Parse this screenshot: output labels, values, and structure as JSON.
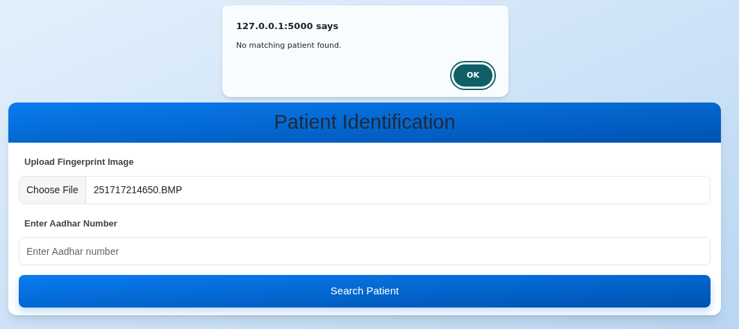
{
  "dialog": {
    "title": "127.0.0.1:5000 says",
    "message": "No matching patient found.",
    "button": "OK"
  },
  "form": {
    "title": "Patient Identification",
    "fingerprint": {
      "label": "Upload Fingerprint Image",
      "button": "Choose File",
      "value": "251717214650.BMP"
    },
    "aadhar": {
      "label": "Enter Aadhar Number",
      "placeholder": "Enter Aadhar number"
    },
    "submit": "Search Patient"
  }
}
